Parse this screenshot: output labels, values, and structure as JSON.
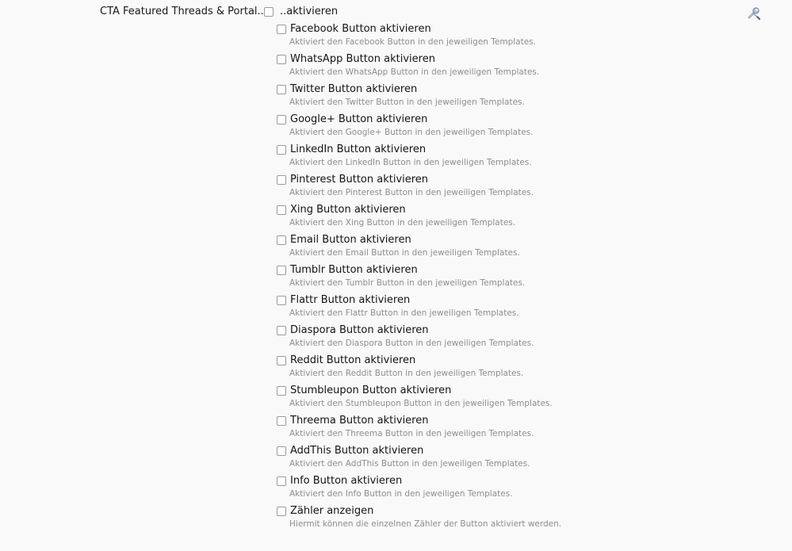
{
  "group": {
    "title": "CTA Featured Threads & Portal..",
    "master_label": "..aktivieren"
  },
  "icons": {
    "edit": "wrench-screwdriver-icon"
  },
  "options": [
    {
      "label": "Facebook Button aktivieren",
      "desc": "Aktiviert den Facebook Button in den jeweiligen Templates."
    },
    {
      "label": "WhatsApp Button aktivieren",
      "desc": "Aktiviert den WhatsApp Button in den jeweiligen Templates."
    },
    {
      "label": "Twitter Button aktivieren",
      "desc": "Aktiviert den Twitter Button in den jeweiligen Templates."
    },
    {
      "label": "Google+ Button aktivieren",
      "desc": "Aktiviert den Google+ Button in den jeweiligen Templates."
    },
    {
      "label": "LinkedIn Button aktivieren",
      "desc": "Aktiviert den LinkedIn Button in den jeweiligen Templates."
    },
    {
      "label": "Pinterest Button aktivieren",
      "desc": "Aktiviert den Pinterest Button in den jeweiligen Templates."
    },
    {
      "label": "Xing Button aktivieren",
      "desc": "Aktiviert den Xing Button in den jeweiligen Templates."
    },
    {
      "label": "Email Button aktivieren",
      "desc": "Aktiviert den Email Button in den jeweiligen Templates."
    },
    {
      "label": "Tumblr Button aktivieren",
      "desc": "Aktiviert den Tumblr Button in den jeweiligen Templates."
    },
    {
      "label": "Flattr Button aktivieren",
      "desc": "Aktiviert den Flattr Button in den jeweiligen Templates."
    },
    {
      "label": "Diaspora Button aktivieren",
      "desc": "Aktiviert den Diaspora Button in den jeweiligen Templates."
    },
    {
      "label": "Reddit Button aktivieren",
      "desc": "Aktiviert den Reddit Button in den jeweiligen Templates."
    },
    {
      "label": "Stumbleupon Button aktivieren",
      "desc": "Aktiviert den Stumbleupon Button in den jeweiligen Templates."
    },
    {
      "label": "Threema Button aktivieren",
      "desc": "Aktiviert den Threema Button in den jeweiligen Templates."
    },
    {
      "label": "AddThis Button aktivieren",
      "desc": "Aktiviert den AddThis Button in den jeweiligen Templates."
    },
    {
      "label": "Info Button aktivieren",
      "desc": "Aktiviert den Info Button in den jeweiligen Templates."
    },
    {
      "label": "Zähler anzeigen",
      "desc": "Hiermit können die einzelnen Zähler der Button aktiviert werden."
    }
  ]
}
